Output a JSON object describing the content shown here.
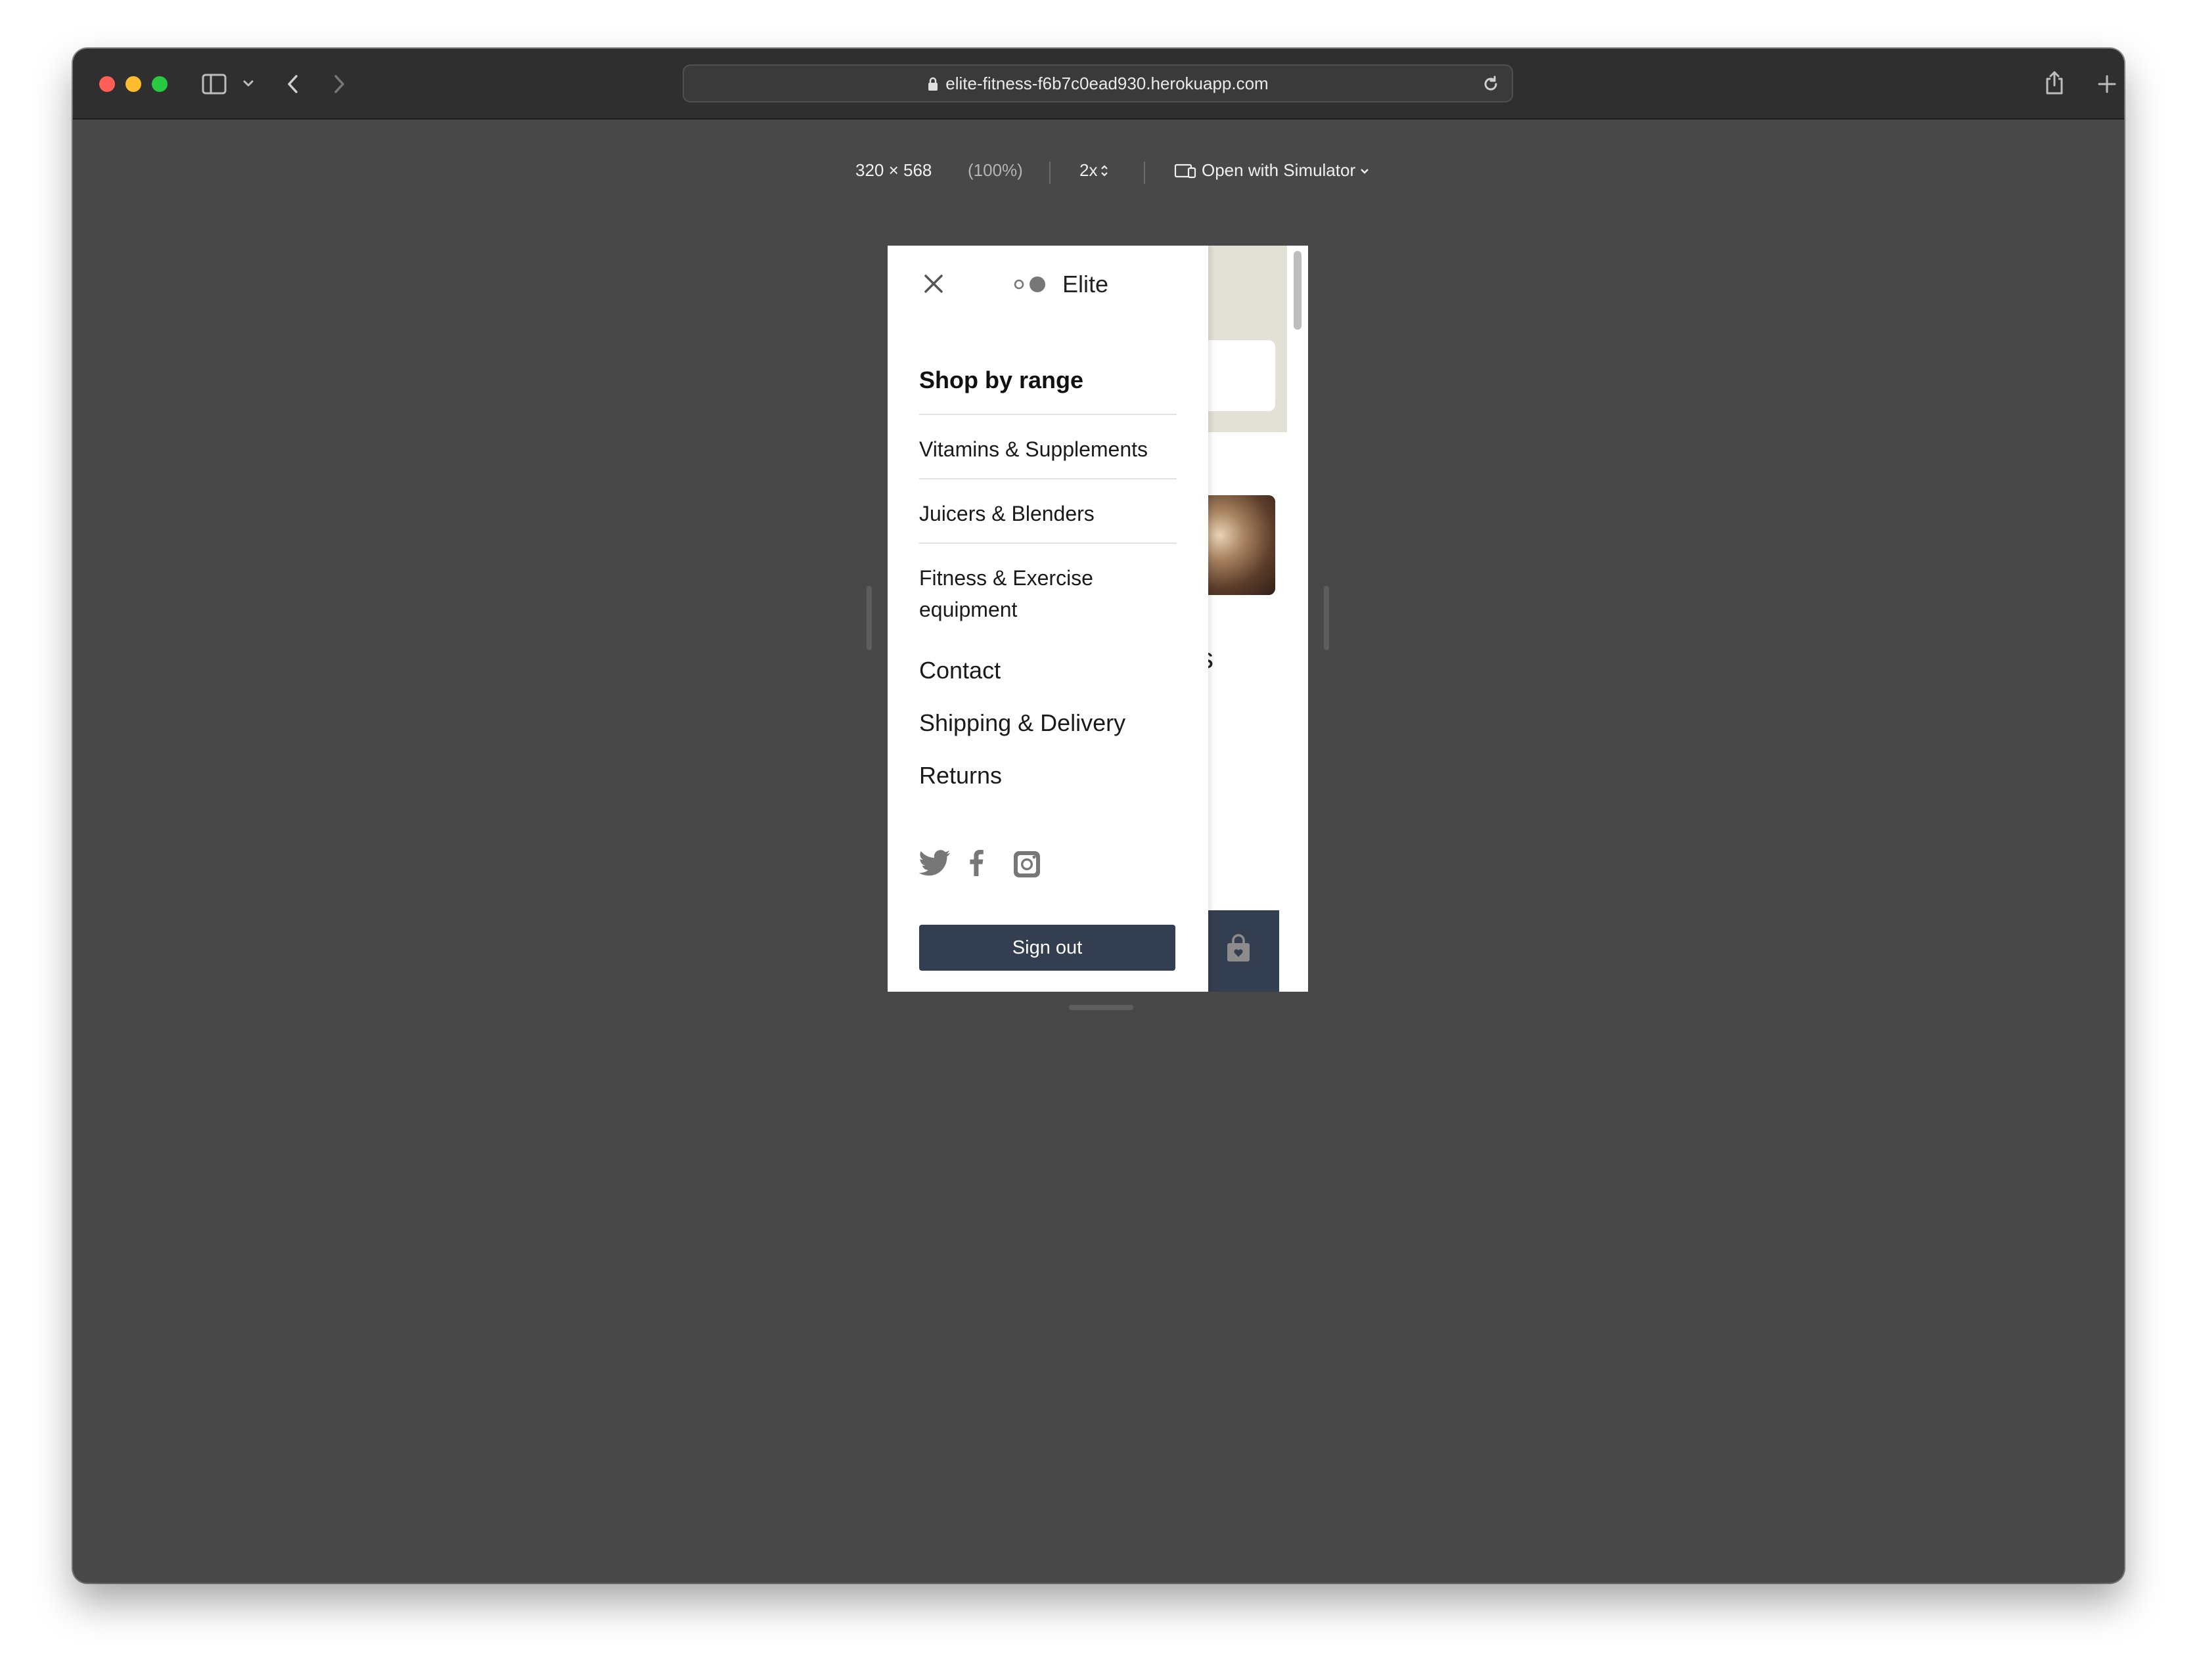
{
  "browser": {
    "url": "elite-fitness-f6b7c0ead930.herokuapp.com",
    "traffic_light_colors": {
      "close": "#ff5f57",
      "minimize": "#febc2e",
      "zoom": "#28c840"
    },
    "toolbar_icons": [
      "sidebar-icon",
      "chevron-down-icon",
      "back-icon",
      "forward-icon",
      "lock-icon",
      "reload-icon",
      "share-icon",
      "plus-icon",
      "tabs-icon"
    ]
  },
  "responsive_mode": {
    "dimensions": "320 × 568",
    "zoom": "(100%)",
    "scale": "2x",
    "open_with": "Open with Simulator"
  },
  "drawer": {
    "brand": "Elite",
    "section_title": "Shop by range",
    "categories": [
      {
        "label": "Vitamins & Supplements"
      },
      {
        "label": "Juicers & Blenders"
      },
      {
        "label": "Fitness & Exercise equipment"
      }
    ],
    "links": [
      {
        "label": "Contact"
      },
      {
        "label": "Shipping & Delivery"
      },
      {
        "label": "Returns"
      }
    ],
    "social_icons": [
      "twitter-icon",
      "facebook-icon",
      "instagram-icon"
    ],
    "sign_out": "Sign out"
  },
  "background_page": {
    "partial_text": "ss"
  },
  "colors": {
    "button": "#333f51",
    "window_background": "#484848",
    "title_bar": "#2f2f2f"
  }
}
